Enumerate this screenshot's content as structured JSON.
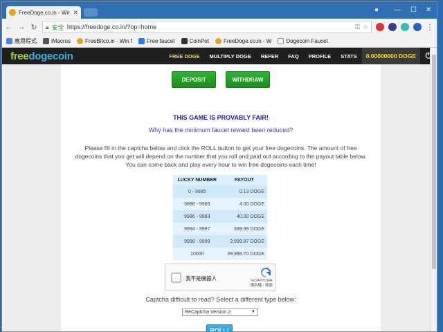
{
  "browser": {
    "tab_title": "FreeDoge.co.in - Win f",
    "address_security": "安全",
    "address_url": "https://freedoge.co.in/?op=home",
    "bookmarks": [
      {
        "label": "應用程式",
        "color": "#4285f4"
      },
      {
        "label": "iMacros",
        "color": "#555555"
      },
      {
        "label": "FreeBitco.in - Win f",
        "color": "#e8a317"
      },
      {
        "label": "Free faucet",
        "color": "#2a7de1"
      },
      {
        "label": "CoinPot",
        "color": "#333333"
      },
      {
        "label": "FreeDoge.co.in - W",
        "color": "#e8a317"
      },
      {
        "label": "Dogecoin Faucet",
        "color": "#888888"
      }
    ]
  },
  "site": {
    "logo_part1": "free",
    "logo_part2": "dogecoin",
    "menu": [
      "FREE DOGE",
      "MULTIPLY DOGE",
      "REFER",
      "FAQ",
      "PROFILE",
      "STATS"
    ],
    "balance": "0.00000000 DOGE",
    "power_icon": "power-icon",
    "deposit_label": "DEPOSIT",
    "withdraw_label": "WITHDRAW",
    "fair_text": "THIS GAME IS PROVABLY FAIR!",
    "why_link": "Why has the minimum faucet reward been reduced?",
    "info_text": "Please fill in the captcha below and click the ROLL button to get your free dogecoins. The amount of free dogecoins that you get will depend on the number that you roll and paid out according to the payout table below. You can come back and play every hour to win free dogecoins each time!",
    "table_headers": [
      "LUCKY NUMBER",
      "PAYOUT"
    ],
    "table_rows": [
      [
        "0 - 9885",
        "0.13 DOGE"
      ],
      [
        "9886 - 9985",
        "4.00 DOGE"
      ],
      [
        "9986 - 9993",
        "40.00 DOGE"
      ],
      [
        "9994 - 9997",
        "399.99 DOGE"
      ],
      [
        "9998 - 9999",
        "3,999.87 DOGE"
      ],
      [
        "10000",
        "39,998.70 DOGE"
      ]
    ],
    "captcha_label": "我不是機器人",
    "captcha_brand": "reCAPTCHA",
    "captcha_terms": "隱私權 - 條款",
    "difficult_text": "Captcha difficult to read? Select a different type below:",
    "select_value": "ReCaptcha Version 2",
    "roll_label": "ROLL!",
    "colors": {
      "green": "#1c8e1c",
      "blue_link": "#3a3ad6",
      "roll": "#1e8bc7",
      "balance": "#f7e200"
    }
  }
}
